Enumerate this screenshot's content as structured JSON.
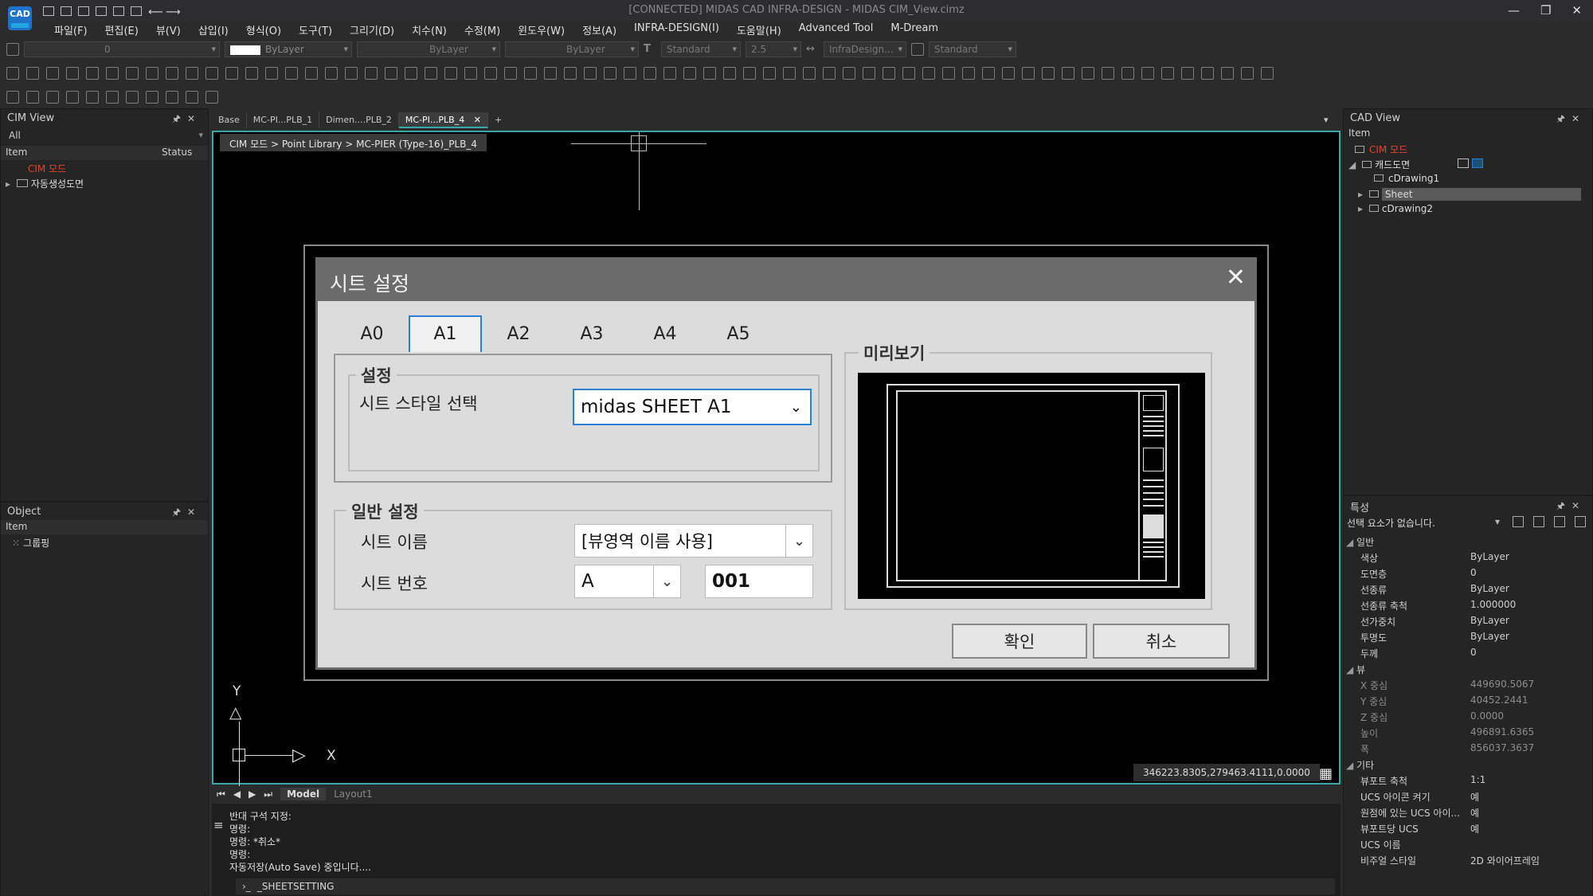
{
  "window": {
    "title": "[CONNECTED] MIDAS CAD INFRA-DESIGN - MIDAS CIM_View.cimz",
    "logo_text": "CAD",
    "controls": [
      "—",
      "❐",
      "✕"
    ]
  },
  "menu": [
    "파일(F)",
    "편집(E)",
    "뷰(V)",
    "삽입(I)",
    "형식(O)",
    "도구(T)",
    "그리기(D)",
    "치수(N)",
    "수정(M)",
    "윈도우(W)",
    "정보(A)",
    "INFRA-DESIGN(I)",
    "도움말(H)",
    "Advanced Tool",
    "M-Dream"
  ],
  "toolbar": {
    "layer_value": "0",
    "color_value": "ByLayer",
    "linetype_value": "ByLayer",
    "lineweight_value": "ByLayer",
    "textstyle_value": "Standard",
    "textheight_value": "2.5",
    "dimstyle_value": "InfraDesign...",
    "tablestyle_value": "Standard"
  },
  "cim_view": {
    "title": "CIM View",
    "filter": "All",
    "col_item": "Item",
    "col_status": "Status",
    "rows": [
      "CIM 모드",
      "자동생성도면"
    ]
  },
  "object_panel": {
    "title": "Object",
    "col_item": "Item",
    "rows": [
      "그룹핑"
    ]
  },
  "doc_tabs": [
    "Base",
    "MC-PI...PLB_1",
    "Dimen....PLB_2",
    "MC-PI...PLB_4"
  ],
  "breadcrumb": "CIM 모드 > Point Library > MC-PIER (Type-16)_PLB_4",
  "ucs": {
    "y": "Y",
    "x": "X"
  },
  "coords": "346223.8305,279463.4111,0.0000",
  "layout_tabs": [
    "Model",
    "Layout1"
  ],
  "dialog": {
    "title": "시트 설정",
    "tabs": [
      "A0",
      "A1",
      "A2",
      "A3",
      "A4",
      "A5"
    ],
    "active_tab": "A1",
    "settings_group": "설정",
    "sheet_style_label": "시트 스타일 선택",
    "sheet_style_value": "midas SHEET A1",
    "general_group": "일반 설정",
    "sheet_name_label": "시트 이름",
    "sheet_name_value": "[뷰영역 이름 사용]",
    "sheet_number_label": "시트 번호",
    "sheet_number_prefix": "A",
    "sheet_number_value": "001",
    "preview_group": "미리보기",
    "ok": "확인",
    "cancel": "취소"
  },
  "cad_view": {
    "title": "CAD View",
    "col_item": "Item",
    "root": "CIM 모드",
    "folder": "캐드도면",
    "items": [
      "cDrawing1",
      "Sheet",
      "cDrawing2"
    ]
  },
  "properties": {
    "title": "특성",
    "selection": "선택 요소가 없습니다.",
    "sections": {
      "general": "일반",
      "view": "뷰",
      "misc": "기타"
    },
    "general": [
      {
        "k": "색상",
        "v": "ByLayer"
      },
      {
        "k": "도면층",
        "v": "0"
      },
      {
        "k": "선종류",
        "v": "ByLayer"
      },
      {
        "k": "선종류 축척",
        "v": "1.000000"
      },
      {
        "k": "선가중치",
        "v": "ByLayer"
      },
      {
        "k": "투명도",
        "v": "ByLayer"
      },
      {
        "k": "두께",
        "v": "0"
      }
    ],
    "view": [
      {
        "k": "X 중심",
        "v": "449690.5067"
      },
      {
        "k": "Y 중심",
        "v": "40452.2441"
      },
      {
        "k": "Z 중심",
        "v": "0.0000"
      },
      {
        "k": "높이",
        "v": "496891.6365"
      },
      {
        "k": "폭",
        "v": "856037.3637"
      }
    ],
    "misc": [
      {
        "k": "뷰포트 축척",
        "v": "1:1"
      },
      {
        "k": "UCS 아이콘 켜기",
        "v": "예"
      },
      {
        "k": "원점에 있는 UCS 아이...",
        "v": "예"
      },
      {
        "k": "뷰포트당 UCS",
        "v": "예"
      },
      {
        "k": "UCS 이름",
        "v": ""
      },
      {
        "k": "비주얼 스타일",
        "v": "2D 와이어프레임"
      }
    ]
  },
  "command": {
    "history": [
      "반대 구석 지정:",
      "명령:",
      "명령: *취소*",
      "명령:",
      "자동저장(Auto Save) 중입니다...."
    ],
    "current": "_SHEETSETTING"
  }
}
